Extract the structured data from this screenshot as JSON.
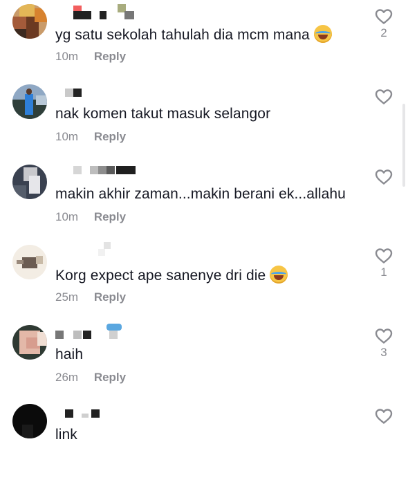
{
  "comments": [
    {
      "text": "yg satu sekolah tahulah dia mcm mana",
      "has_emoji": true,
      "emoji_name": "face-with-tears-of-joy-icon",
      "time": "10m",
      "reply_label": "Reply",
      "likes": "2"
    },
    {
      "text": "nak komen takut masuk selangor",
      "has_emoji": false,
      "time": "10m",
      "reply_label": "Reply",
      "likes": ""
    },
    {
      "text": "makin akhir zaman...makin berani ek...allahu",
      "has_emoji": false,
      "time": "10m",
      "reply_label": "Reply",
      "likes": ""
    },
    {
      "text": "Korg expect ape sanenye dri die",
      "has_emoji": true,
      "emoji_name": "face-with-tears-of-joy-icon",
      "time": "25m",
      "reply_label": "Reply",
      "likes": "1"
    },
    {
      "text": "haih",
      "has_emoji": false,
      "time": "26m",
      "reply_label": "Reply",
      "likes": "3"
    },
    {
      "text": "link",
      "has_emoji": false,
      "time": "",
      "reply_label": "",
      "likes": ""
    }
  ],
  "icons": {
    "like": "heart-outline-icon"
  },
  "colors": {
    "text": "#161823",
    "secondary": "#8a8b91",
    "icon": "#8a8b91"
  }
}
